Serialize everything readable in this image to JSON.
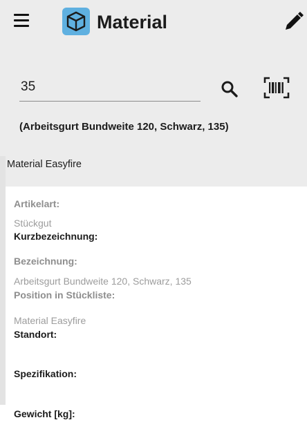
{
  "app": {
    "title": "Material"
  },
  "search": {
    "value": "35"
  },
  "material": {
    "headline": "(Arbeitsgurt Bundweite 120, Schwarz, 135)",
    "subline": "Material Easyfire"
  },
  "details": {
    "artikelart_label": "Artikelart:",
    "artikelart_value": "Stückgut",
    "kurzbezeichnung_label": "Kurzbezeichnung:",
    "bezeichnung_label": "Bezeichnung:",
    "bezeichnung_value": "Arbeitsgurt Bundweite 120, Schwarz, 135",
    "position_label": "Position in Stückliste:",
    "position_value": "Material Easyfire",
    "standort_label": "Standort:",
    "spezifikation_label": "Spezifikation:",
    "gewicht_label": "Gewicht [kg]:"
  },
  "icons": {
    "menu": "menu-icon",
    "logo": "cube-icon",
    "edit": "pencil-icon",
    "search": "search-icon",
    "barcode": "barcode-scan-icon"
  },
  "colors": {
    "header_bg": "#ececec",
    "logo_bg": "#5fb0e0",
    "label_gray": "#8e8e8e",
    "value_gray": "#9c9c9c",
    "text_dark": "#1b1b1b"
  }
}
